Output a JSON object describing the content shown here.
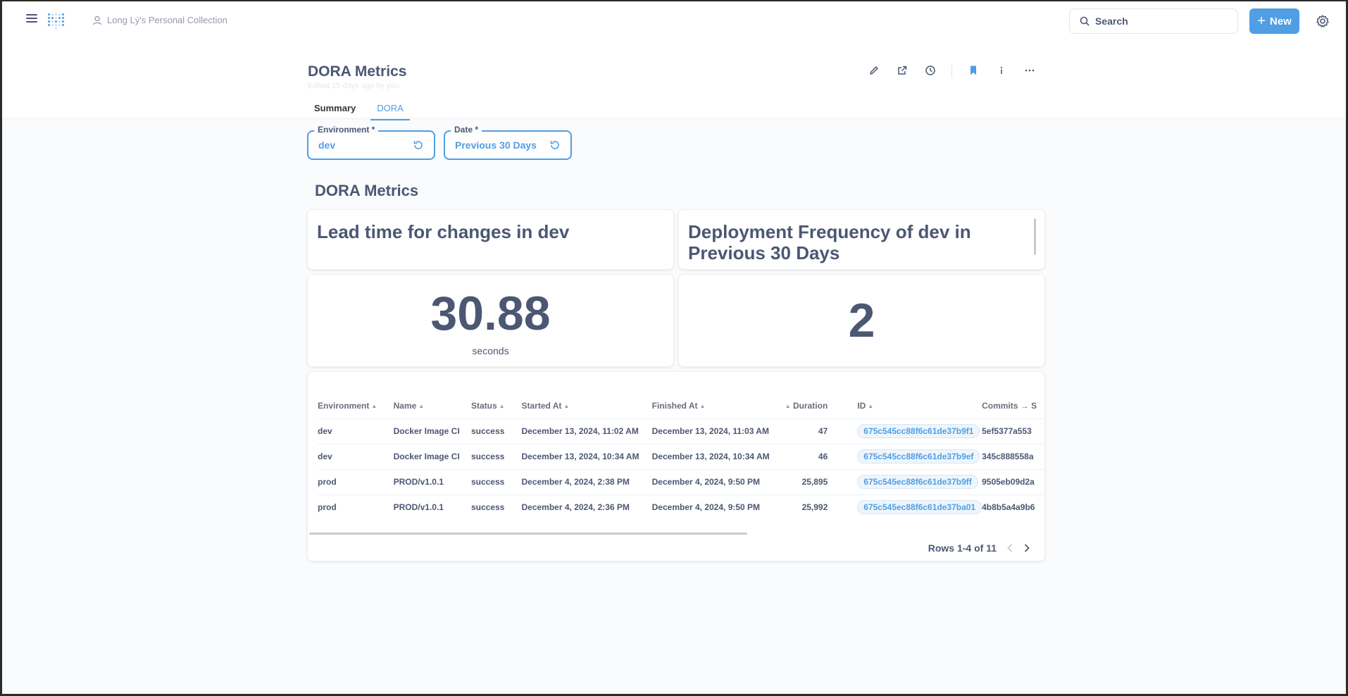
{
  "nav": {
    "collection": "Long Lý's Personal Collection",
    "search_placeholder": "Search",
    "new_label": "New"
  },
  "dashboard": {
    "title": "DORA Metrics",
    "edited": "Edited 15 days ago by you",
    "tabs": [
      {
        "label": "Summary",
        "active": false
      },
      {
        "label": "DORA",
        "active": true
      }
    ]
  },
  "filters": [
    {
      "label": "Environment *",
      "value": "dev"
    },
    {
      "label": "Date *",
      "value": "Previous 30 Days"
    }
  ],
  "section_title": "DORA Metrics",
  "cards": {
    "lead_time_title": "Lead time for changes in dev",
    "deploy_freq_title": "Deployment Frequency of dev in Previous 30 Days",
    "lead_time_value": "30.88",
    "lead_time_unit": "seconds",
    "deploy_freq_value": "2"
  },
  "table": {
    "columns": [
      "Environment",
      "Name",
      "Status",
      "Started At",
      "Finished At",
      "Duration",
      "ID",
      "Commits → S"
    ],
    "rows": [
      [
        "dev",
        "Docker Image CI",
        "success",
        "December 13, 2024, 11:02 AM",
        "December 13, 2024, 11:03 AM",
        "47",
        "675c545cc88f6c61de37b9f1",
        "5ef5377a553"
      ],
      [
        "dev",
        "Docker Image CI",
        "success",
        "December 13, 2024, 10:34 AM",
        "December 13, 2024, 10:34 AM",
        "46",
        "675c545cc88f6c61de37b9ef",
        "345c888558a"
      ],
      [
        "prod",
        "PROD/v1.0.1",
        "success",
        "December 4, 2024, 2:38 PM",
        "December 4, 2024, 9:50 PM",
        "25,895",
        "675c545ec88f6c61de37b9ff",
        "9505eb09d2a"
      ],
      [
        "prod",
        "PROD/v1.0.1",
        "success",
        "December 4, 2024, 2:36 PM",
        "December 4, 2024, 9:50 PM",
        "25,992",
        "675c545ec88f6c61de37ba01",
        "4b8b5a4a9b6"
      ]
    ],
    "pagination": "Rows 1-4 of 11"
  },
  "colors": {
    "accent": "#509ee3",
    "text": "#4c5773",
    "background": "#f9fbfc"
  }
}
